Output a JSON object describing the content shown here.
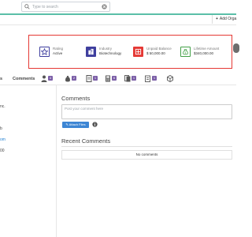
{
  "search": {
    "placeholder": "Type to search",
    "value": ""
  },
  "header": {
    "add_org_plus": "+",
    "add_org_label": "Add Orga"
  },
  "cards": [
    {
      "label": "Rating",
      "value": "Active",
      "color": "#3f3f9e",
      "icon": "star-icon"
    },
    {
      "label": "Industry",
      "value": "Biotechnology",
      "color": "#3f3f9e",
      "icon": "building-icon"
    },
    {
      "label": "Unpaid Balance",
      "value": "$ 50,000.00",
      "color": "#e53935",
      "icon": "balance-icon"
    },
    {
      "label": "Lifetime Amount",
      "value": "$340,000.00",
      "color": "#43a047",
      "icon": "money-bag-icon"
    }
  ],
  "tabs": {
    "partial_label": "s",
    "comments_label": "Comments",
    "icons": [
      {
        "icon": "contact-icon",
        "badge": "4"
      },
      {
        "icon": "money-bag-icon",
        "badge": "2"
      },
      {
        "icon": "document-icon",
        "badge": "1"
      },
      {
        "icon": "calculator-icon",
        "badge": "6"
      },
      {
        "icon": "documents-icon",
        "badge": "1"
      },
      {
        "icon": "files-icon",
        "badge": "1"
      },
      {
        "icon": "box-icon",
        "badge": ""
      }
    ]
  },
  "left_column": {
    "line1": "nc.",
    "line2": "b",
    "link": "om",
    "line4": "00"
  },
  "comments": {
    "title": "Comments",
    "placeholder": "Post your comment here",
    "attach_label": "Attach Files",
    "recent_title": "Recent Comments",
    "empty_text": "No comments"
  },
  "colors": {
    "accent": "#5bbfa8",
    "highlight": "#e53935",
    "badge": "#7b5ea7",
    "button": "#3d86d4"
  }
}
